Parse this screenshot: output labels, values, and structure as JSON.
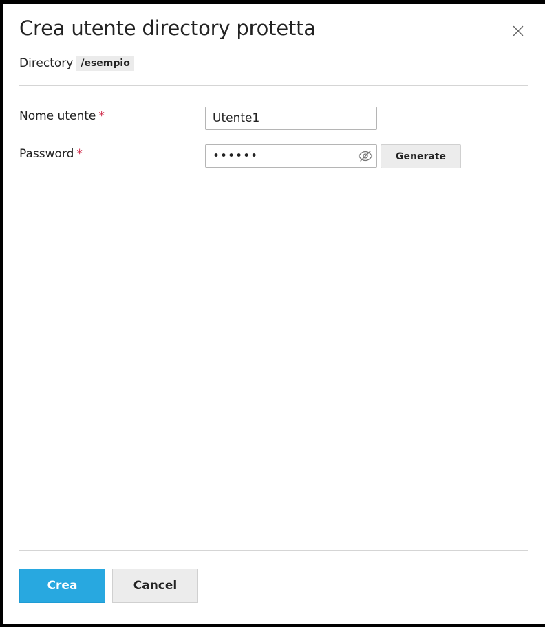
{
  "dialog": {
    "title": "Crea utente directory protetta",
    "close_icon": "close-icon",
    "directory_label": "Directory",
    "directory_path": "/esempio"
  },
  "form": {
    "username": {
      "label": "Nome utente",
      "required_marker": "*",
      "value": "Utente1"
    },
    "password": {
      "label": "Password",
      "required_marker": "*",
      "value": "secret",
      "toggle_icon": "eye-slash-icon"
    },
    "generate_label": "Generate"
  },
  "footer": {
    "submit_label": "Crea",
    "cancel_label": "Cancel"
  },
  "colors": {
    "primary": "#28a8e0",
    "required": "#d02d4c",
    "chip_background": "#ebebeb",
    "button_background": "#ececec"
  }
}
